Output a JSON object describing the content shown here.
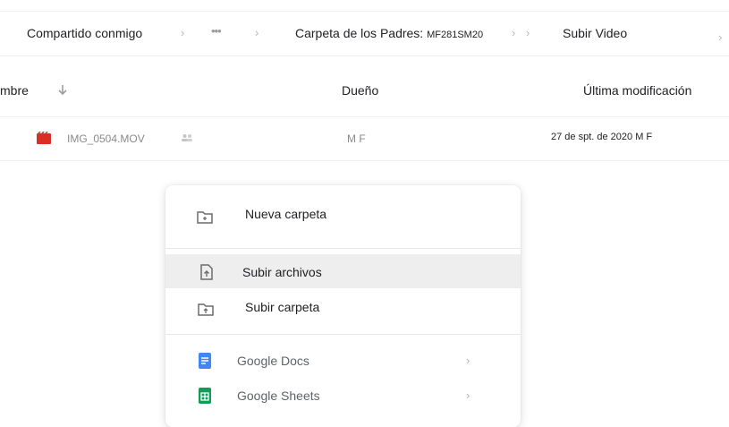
{
  "breadcrumb": {
    "item1": "Compartido conmigo",
    "ellipsis": "•••",
    "item2_main": "Carpeta de los Padres: ",
    "item2_code": "MF281SM20",
    "item3": "Subir Video"
  },
  "table": {
    "headers": {
      "name": "mbre",
      "owner": "Dueño",
      "modified": "Última modificación"
    },
    "rows": [
      {
        "name": "IMG_0504.MOV",
        "owner": "M F",
        "modified": "27 de spt. de 2020 M F"
      }
    ]
  },
  "menu": {
    "items": [
      {
        "label": "Nueva carpeta",
        "icon": "new-folder-icon"
      },
      {
        "label": "Subir archivos",
        "icon": "upload-file-icon",
        "highlighted": true
      },
      {
        "label": "Subir carpeta",
        "icon": "upload-folder-icon"
      },
      {
        "label": "Google Docs",
        "icon": "google-docs-icon"
      },
      {
        "label": "Google Sheets",
        "icon": "google-sheets-icon"
      }
    ]
  },
  "colors": {
    "docs": "#4285f4",
    "sheets": "#0f9d58",
    "video": "#d93025",
    "highlight": "#eeeeee"
  }
}
